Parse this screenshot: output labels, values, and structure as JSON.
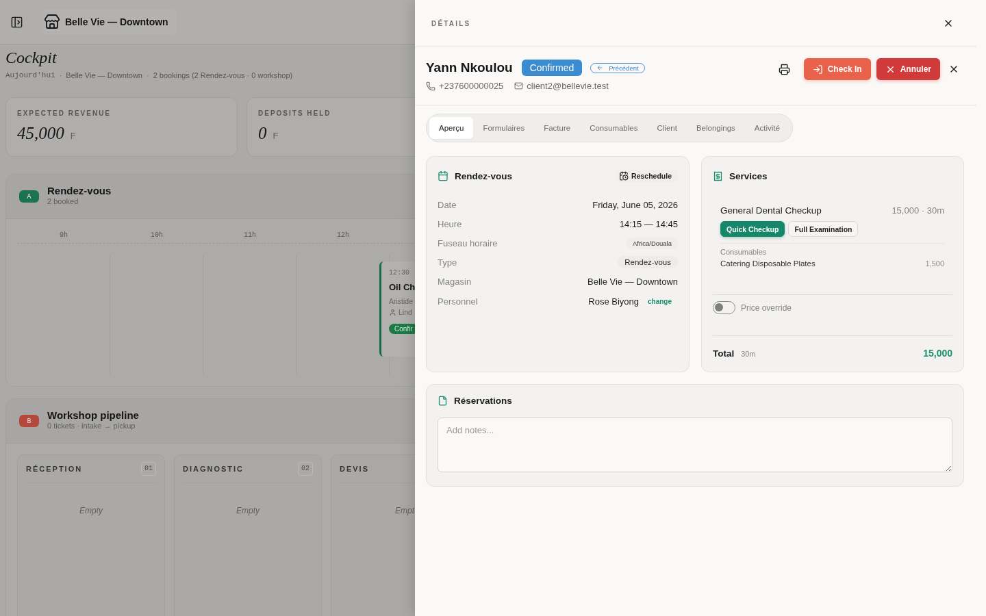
{
  "topbar": {
    "location": "Belle Vie — Downtown"
  },
  "header": {
    "title": "Cockpit",
    "subtitle": [
      {
        "kind": "date",
        "text": "Aujourd'hui"
      },
      {
        "kind": "sep",
        "text": "·"
      },
      {
        "kind": "text",
        "text": "Belle Vie — Downtown"
      },
      {
        "kind": "sep",
        "text": "·"
      },
      {
        "kind": "text",
        "text": "2 bookings (2 Rendez-vous · 0 workshop)"
      }
    ]
  },
  "stats": [
    {
      "label": "EXPECTED REVENUE",
      "value": "45,000",
      "unit": "F"
    },
    {
      "label": "DEPOSITS HELD",
      "value": "0",
      "unit": "F"
    }
  ],
  "sections": [
    {
      "kind": "timeline",
      "badge": "A",
      "color": "#1c7352",
      "title": "Rendez-vous",
      "subtitle": "2 booked",
      "hours": [
        "9h",
        "10h",
        "11h",
        "12h"
      ],
      "events": [
        {
          "time": "12:30",
          "title": "Oil Ch",
          "client": "Aristide",
          "staff": "Lind",
          "status": "Confir"
        }
      ]
    },
    {
      "kind": "pipeline",
      "badge": "B",
      "color": "#b4493b",
      "title": "Workshop pipeline",
      "subtitle": "0 tickets · intake → pickup",
      "columns": [
        {
          "title": "RÉCEPTION",
          "count": "01",
          "empty": "Empty"
        },
        {
          "title": "DIAGNOSTIC",
          "count": "02",
          "empty": "Empty"
        },
        {
          "title": "DEVIS",
          "empty": "Empt"
        }
      ]
    }
  ],
  "drawer": {
    "title": "DÉTAILS",
    "client": {
      "name": "Yann Nkoulou",
      "status": "Confirmed",
      "back": "Précédent",
      "phone": "+237600000025",
      "email": "client2@bellevie.test"
    },
    "actions": [
      {
        "kind": "checkin",
        "label": "Check In"
      },
      {
        "kind": "cancel",
        "label": "Annuler"
      }
    ],
    "tabs": [
      {
        "label": "Aperçu",
        "selected": true
      },
      {
        "label": "Formulaires",
        "selected": false
      },
      {
        "label": "Facture",
        "selected": false
      },
      {
        "label": "Consumables",
        "selected": false
      },
      {
        "label": "Client",
        "selected": false
      },
      {
        "label": "Belongings",
        "selected": false
      },
      {
        "label": "Activité",
        "selected": false
      }
    ],
    "appointment": {
      "title": "Rendez-vous",
      "action": "Reschedule",
      "rows": [
        {
          "label": "Date",
          "kind": "text",
          "value": "Friday, June 05, 2026"
        },
        {
          "label": "Heure",
          "kind": "text",
          "value": "14:15 — 14:45"
        },
        {
          "label": "Fuseau horaire",
          "kind": "mini",
          "value": "Africa/Douala"
        },
        {
          "label": "Type",
          "kind": "tag",
          "value": "Rendez-vous"
        },
        {
          "label": "Magasin",
          "kind": "text",
          "value": "Belle Vie — Downtown"
        },
        {
          "label": "Personnel",
          "kind": "staff",
          "value": "Rose Biyong",
          "link": "change"
        }
      ]
    },
    "services": {
      "title": "Services",
      "items": [
        {
          "name": "General Dental Checkup",
          "price": "15,000 · 30m",
          "variants": [
            {
              "label": "Quick Checkup",
              "selected": true
            },
            {
              "label": "Full Examination",
              "selected": false
            }
          ],
          "consumables_title": "Consumables",
          "consumables": [
            {
              "name": "Catering Disposable Plates",
              "price": "1,500"
            }
          ]
        }
      ],
      "price_override": {
        "label": "Price override",
        "on": false
      },
      "total": {
        "label": "Total",
        "duration": "30m",
        "amount": "15,000"
      }
    },
    "notes": {
      "title": "Réservations",
      "placeholder": "Add notes..."
    }
  }
}
